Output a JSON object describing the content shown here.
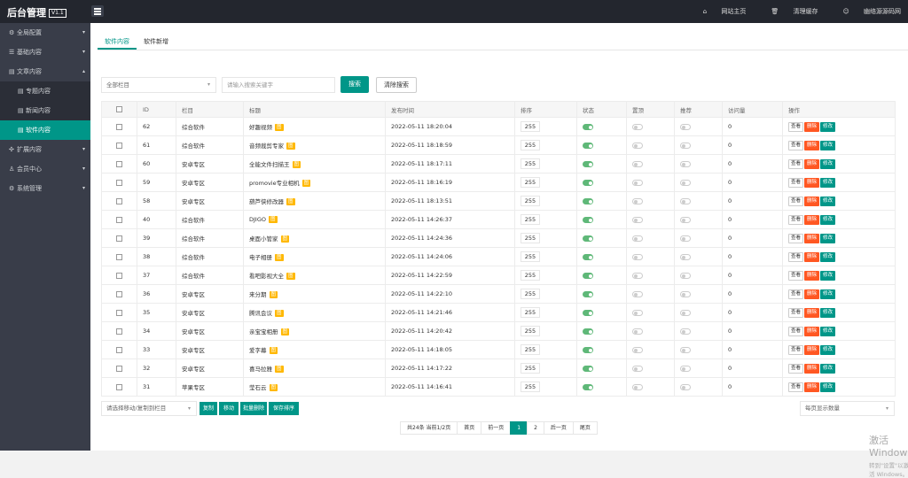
{
  "app": {
    "title": "后台管理",
    "version": "V1.1"
  },
  "topnav": [
    {
      "icon": "home-icon",
      "glyph": "⌂",
      "label": "网站主页"
    },
    {
      "icon": "trash-icon",
      "glyph": "🗑",
      "label": "清理缓存"
    },
    {
      "icon": "user-icon",
      "glyph": "☺",
      "label": "幽络源源码网"
    }
  ],
  "sidebar": [
    {
      "label": "全局配置",
      "icon": "settings-icon",
      "glyph": "⚙",
      "arrow": "▾"
    },
    {
      "label": "基础内容",
      "icon": "list-icon",
      "glyph": "☰",
      "arrow": "▾"
    },
    {
      "label": "文章内容",
      "icon": "document-icon",
      "glyph": "▤",
      "arrow": "▴"
    },
    {
      "label": "扩展内容",
      "icon": "extend-icon",
      "glyph": "✣",
      "arrow": "▾"
    },
    {
      "label": "会员中心",
      "icon": "member-icon",
      "glyph": "♙",
      "arrow": "▾"
    },
    {
      "label": "系统管理",
      "icon": "system-icon",
      "glyph": "⚙",
      "arrow": "▾"
    }
  ],
  "sidebar_sub": [
    {
      "label": "专题内容",
      "active": false
    },
    {
      "label": "新闻内容",
      "active": false
    },
    {
      "label": "软件内容",
      "active": true
    }
  ],
  "tabs": [
    {
      "label": "软件内容",
      "active": true
    },
    {
      "label": "软件新增",
      "active": false
    }
  ],
  "filters": {
    "category": "全部栏目",
    "keyword_placeholder": "请输入搜索关键字",
    "search": "搜索",
    "clear": "清除搜索"
  },
  "table": {
    "columns": [
      "ID",
      "栏目",
      "标题",
      "发布时间",
      "排序",
      "状态",
      "置顶",
      "推荐",
      "访问量",
      "操作"
    ],
    "badge": "图",
    "op_view": "查看",
    "op_delete": "删除",
    "op_edit": "修改",
    "rows": [
      {
        "id": "62",
        "category": "综合软件",
        "title": "好趣视频",
        "date": "2022-05-11 18:20:04",
        "sort": "255",
        "views": "0"
      },
      {
        "id": "61",
        "category": "综合软件",
        "title": "音频裁剪专家",
        "date": "2022-05-11 18:18:59",
        "sort": "255",
        "views": "0"
      },
      {
        "id": "60",
        "category": "安卓专区",
        "title": "全能文件扫描王",
        "date": "2022-05-11 18:17:11",
        "sort": "255",
        "views": "0"
      },
      {
        "id": "59",
        "category": "安卓专区",
        "title": "promovie专业相机",
        "date": "2022-05-11 18:16:19",
        "sort": "255",
        "views": "0"
      },
      {
        "id": "58",
        "category": "安卓专区",
        "title": "葫芦侠修改器",
        "date": "2022-05-11 18:13:51",
        "sort": "255",
        "views": "0"
      },
      {
        "id": "40",
        "category": "综合软件",
        "title": "DJIGO",
        "date": "2022-05-11 14:26:37",
        "sort": "255",
        "views": "0"
      },
      {
        "id": "39",
        "category": "综合软件",
        "title": "桌面小管家",
        "date": "2022-05-11 14:24:36",
        "sort": "255",
        "views": "0"
      },
      {
        "id": "38",
        "category": "综合软件",
        "title": "电子相册",
        "date": "2022-05-11 14:24:06",
        "sort": "255",
        "views": "0"
      },
      {
        "id": "37",
        "category": "综合软件",
        "title": "看吧影视大全",
        "date": "2022-05-11 14:22:59",
        "sort": "255",
        "views": "0"
      },
      {
        "id": "36",
        "category": "安卓专区",
        "title": "来分期",
        "date": "2022-05-11 14:22:10",
        "sort": "255",
        "views": "0"
      },
      {
        "id": "35",
        "category": "安卓专区",
        "title": "腾讯会议",
        "date": "2022-05-11 14:21:46",
        "sort": "255",
        "views": "0"
      },
      {
        "id": "34",
        "category": "安卓专区",
        "title": "亲宝宝相册",
        "date": "2022-05-11 14:20:42",
        "sort": "255",
        "views": "0"
      },
      {
        "id": "33",
        "category": "安卓专区",
        "title": "爱字幕",
        "date": "2022-05-11 14:18:05",
        "sort": "255",
        "views": "0"
      },
      {
        "id": "32",
        "category": "安卓专区",
        "title": "喜马拉雅",
        "date": "2022-05-11 14:17:22",
        "sort": "255",
        "views": "0"
      },
      {
        "id": "31",
        "category": "苹果专区",
        "title": "莹石云",
        "date": "2022-05-11 14:16:41",
        "sort": "255",
        "views": "0"
      }
    ]
  },
  "bulk": {
    "select_placeholder": "请选择移动/复制到栏目",
    "copy": "复制",
    "move": "移动",
    "batch_delete": "批量删除",
    "save_sort": "保存排序"
  },
  "page_size_placeholder": "每页显示数量",
  "pager": {
    "summary": "共24条 当前1/2页",
    "first": "首页",
    "prev": "前一页",
    "pages": [
      "1",
      "2"
    ],
    "current": "1",
    "next": "后一页",
    "last": "尾页"
  },
  "watermark": {
    "line1": "激活 Windows",
    "line2": "转到\"设置\"以激活 Windows。"
  },
  "colors": {
    "accent": "#009688",
    "danger": "#ff5722",
    "badge": "#ffb800",
    "switch_on": "#5fb878",
    "sidebar": "#393d49",
    "topbar": "#23262e"
  }
}
